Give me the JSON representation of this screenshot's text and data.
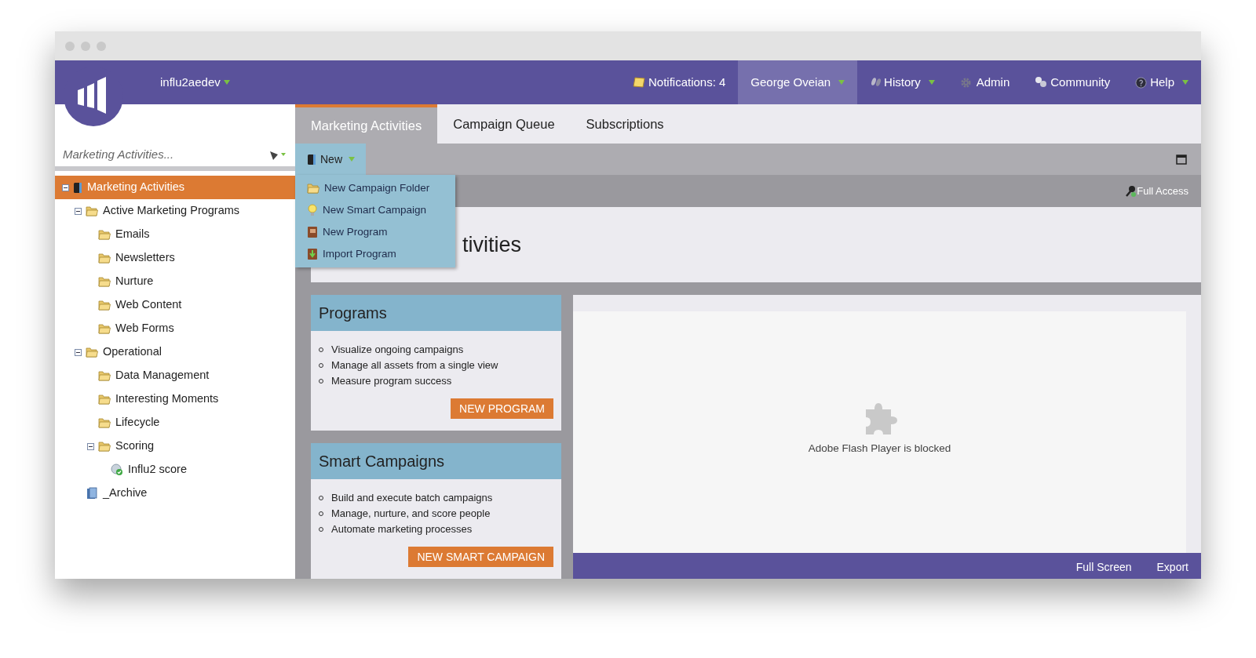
{
  "header": {
    "account": {
      "label": "influ2aedev",
      "menu": true
    },
    "nav": [
      {
        "kind": "notifications",
        "label": "Notifications: 4",
        "selected": false,
        "menu": false
      },
      {
        "kind": "user",
        "label": "George Oveian",
        "selected": true,
        "menu": true
      },
      {
        "kind": "history",
        "label": "History",
        "selected": false,
        "menu": true
      },
      {
        "kind": "admin",
        "label": "Admin",
        "selected": false,
        "menu": false
      },
      {
        "kind": "community",
        "label": "Community",
        "selected": false,
        "menu": false
      },
      {
        "kind": "help",
        "label": "Help",
        "selected": false,
        "menu": true
      }
    ]
  },
  "sidebar": {
    "search": {
      "placeholder": "Marketing Activities..."
    },
    "tree": [
      {
        "kind": "root",
        "label": "Marketing Activities",
        "selected": true,
        "expanded": true,
        "children": [
          {
            "kind": "folder",
            "label": "Active Marketing Programs",
            "selected": false,
            "expanded": true,
            "children": [
              {
                "kind": "folder",
                "label": "Emails",
                "selected": false
              },
              {
                "kind": "folder",
                "label": "Newsletters",
                "selected": false
              },
              {
                "kind": "folder",
                "label": "Nurture",
                "selected": false
              },
              {
                "kind": "folder",
                "label": "Web Content",
                "selected": false
              },
              {
                "kind": "folder",
                "label": "Web Forms",
                "selected": false
              }
            ]
          },
          {
            "kind": "folder",
            "label": "Operational",
            "selected": false,
            "expanded": true,
            "children": [
              {
                "kind": "folder",
                "label": "Data Management",
                "selected": false
              },
              {
                "kind": "folder",
                "label": "Interesting Moments",
                "selected": false
              },
              {
                "kind": "folder",
                "label": "Lifecycle",
                "selected": false
              },
              {
                "kind": "folder",
                "label": "Scoring",
                "selected": false,
                "expanded": true,
                "children": [
                  {
                    "kind": "campaign",
                    "label": "Influ2 score",
                    "selected": false
                  }
                ]
              }
            ]
          },
          {
            "kind": "archive",
            "label": "_Archive",
            "selected": false
          }
        ]
      }
    ]
  },
  "tabs": [
    {
      "label": "Marketing Activities",
      "selected": true
    },
    {
      "label": "Campaign Queue",
      "selected": false
    },
    {
      "label": "Subscriptions",
      "selected": false
    }
  ],
  "toolbar": {
    "new_button": {
      "label": "New",
      "menu": true
    },
    "menu": [
      {
        "kind": "folder",
        "label": "New Campaign Folder"
      },
      {
        "kind": "smart_campaign",
        "label": "New Smart Campaign"
      },
      {
        "kind": "program",
        "label": "New Program"
      },
      {
        "kind": "import",
        "label": "Import Program"
      }
    ]
  },
  "access": "Full Access",
  "heading": "tivities",
  "cards": [
    {
      "title": "Programs",
      "bullets": [
        "Visualize ongoing campaigns",
        "Manage all assets from a single view",
        "Measure program success"
      ],
      "button": "NEW PROGRAM"
    },
    {
      "title": "Smart Campaigns",
      "bullets": [
        "Build and execute batch campaigns",
        "Manage, nurture, and score people",
        "Automate marketing processes"
      ],
      "button": "NEW SMART CAMPAIGN"
    }
  ],
  "flash": {
    "message": "Adobe Flash Player is blocked"
  },
  "footer": [
    "Full Screen",
    "Export"
  ]
}
